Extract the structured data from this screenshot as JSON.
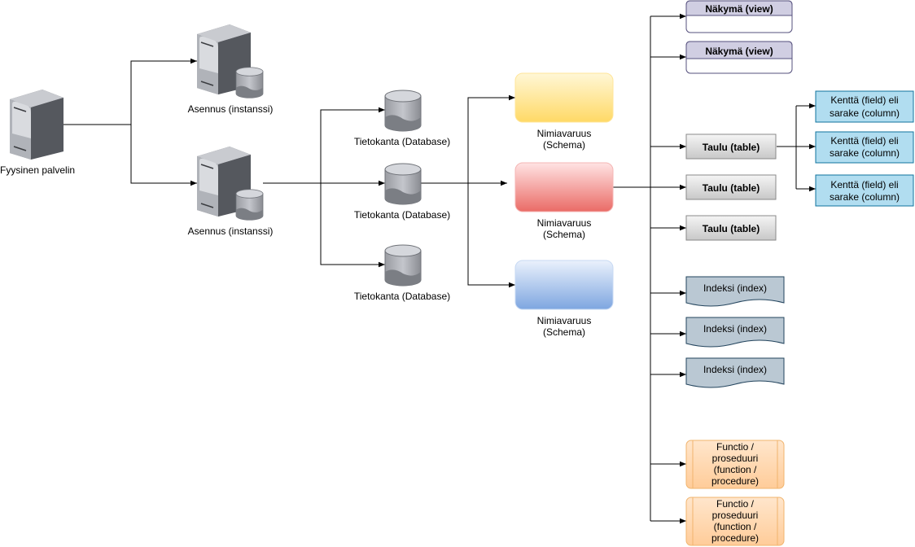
{
  "physical_server": {
    "label": "Fyysinen palvelin"
  },
  "instances": [
    {
      "label": "Asennus (instanssi)"
    },
    {
      "label": "Asennus (instanssi)"
    }
  ],
  "databases": [
    {
      "label": "Tietokanta (Database)"
    },
    {
      "label": "Tietokanta (Database)"
    },
    {
      "label": "Tietokanta (Database)"
    }
  ],
  "schemas": [
    {
      "line1": "Nimiavaruus",
      "line2": "(Schema)",
      "color": "#ffd966"
    },
    {
      "line1": "Nimiavaruus",
      "line2": "(Schema)",
      "color": "#ea6b66"
    },
    {
      "line1": "Nimiavaruus",
      "line2": "(Schema)",
      "color": "#7ea6e0"
    }
  ],
  "views": [
    {
      "label": "Näkymä (view)"
    },
    {
      "label": "Näkymä (view)"
    }
  ],
  "tables": [
    {
      "label": "Taulu (table)"
    },
    {
      "label": "Taulu (table)"
    },
    {
      "label": "Taulu (table)"
    }
  ],
  "fields": [
    {
      "line1": "Kenttä (field) eli",
      "line2": "sarake (column)"
    },
    {
      "line1": "Kenttä (field) eli",
      "line2": "sarake (column)"
    },
    {
      "line1": "Kenttä (field) eli",
      "line2": "sarake (column)"
    }
  ],
  "indexes": [
    {
      "label": "Indeksi (index)"
    },
    {
      "label": "Indeksi (index)"
    },
    {
      "label": "Indeksi (index)"
    }
  ],
  "functions": [
    {
      "lines": [
        "Functio /",
        "proseduuri",
        "(function /",
        "procedure)"
      ]
    },
    {
      "lines": [
        "Functio /",
        "proseduuri",
        "(function /",
        "procedure)"
      ]
    }
  ],
  "colors": {
    "view_header": "#d0cee2",
    "view_border": "#56517e",
    "table_fill": "#e0e0e0",
    "field_fill": "#b1ddf0",
    "field_border": "#10739e",
    "index_fill": "#bac8d3",
    "index_border": "#23445d",
    "function_fill": "#ffcc99",
    "function_border": "#d79b00"
  }
}
